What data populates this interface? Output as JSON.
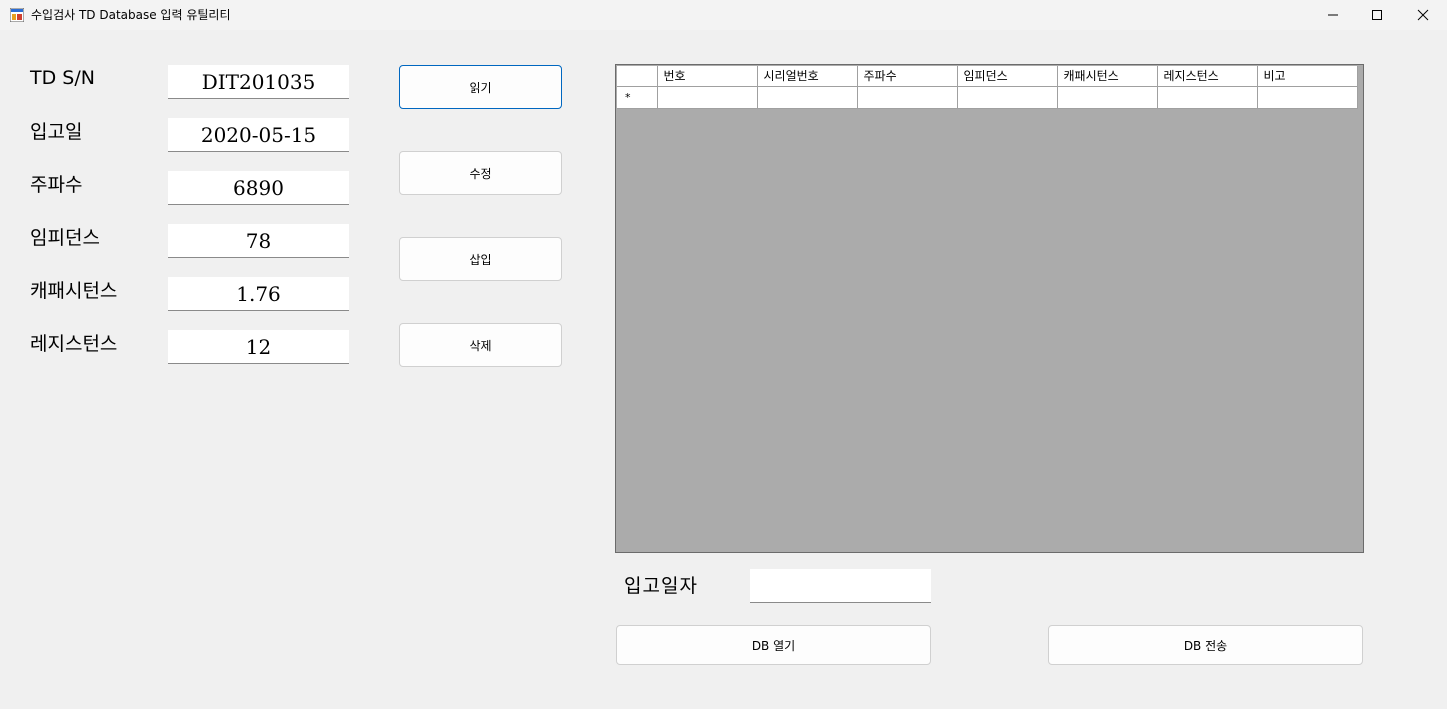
{
  "window": {
    "title": "수입검사 TD Database 입력 유틸리티"
  },
  "fields": [
    {
      "label": "TD S/N",
      "value": "DIT201035"
    },
    {
      "label": "입고일",
      "value": "2020-05-15"
    },
    {
      "label": "주파수",
      "value": "6890"
    },
    {
      "label": "임피던스",
      "value": "78"
    },
    {
      "label": "캐패시턴스",
      "value": "1.76"
    },
    {
      "label": "레지스턴스",
      "value": "12"
    }
  ],
  "buttons": {
    "read": "읽기",
    "edit": "수정",
    "insert": "삽입",
    "delete": "삭제",
    "db_open": "DB 열기",
    "db_send": "DB 전송"
  },
  "grid": {
    "columns": [
      "번호",
      "시리얼번호",
      "주파수",
      "임피던스",
      "캐패시턴스",
      "레지스턴스",
      "비고"
    ],
    "new_row_marker": "*"
  },
  "bottom": {
    "date_label": "입고일자",
    "date_value": ""
  },
  "colors": {
    "accent": "#0067c0",
    "grid_background": "#ababab"
  }
}
